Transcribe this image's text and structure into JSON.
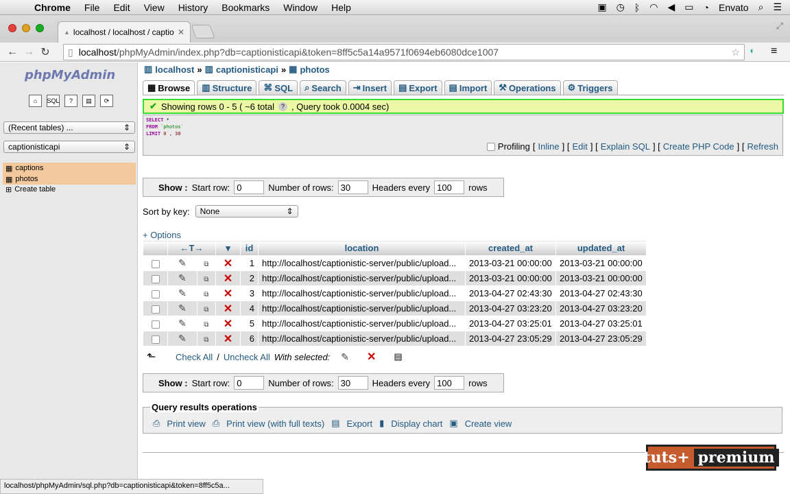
{
  "menubar": {
    "app": "Chrome",
    "items": [
      "File",
      "Edit",
      "View",
      "History",
      "Bookmarks",
      "Window",
      "Help"
    ],
    "user": "Envato"
  },
  "browser": {
    "tab_title": "localhost / localhost / captio",
    "url_host": "localhost",
    "url_path": "/phpMyAdmin/index.php?db=captionisticapi&token=8ff5c5a14a9571f0694eb6080dce1007"
  },
  "sidebar": {
    "logo": "phpMyAdmin",
    "recent": "(Recent tables) ...",
    "db": "captionisticapi",
    "tables": [
      "captions",
      "photos"
    ],
    "create": "Create table"
  },
  "breadcrumb": {
    "server": "localhost",
    "db": "captionisticapi",
    "table": "photos"
  },
  "tabs": [
    "Browse",
    "Structure",
    "SQL",
    "Search",
    "Insert",
    "Export",
    "Import",
    "Operations",
    "Triggers"
  ],
  "success": "Showing rows 0 - 5 ( ~6 total",
  "success2": ", Query took 0.0004 sec)",
  "sql": {
    "l1a": "SELECT",
    "l1b": "*",
    "l2a": "FROM",
    "l2b": "`photos`",
    "l3a": "LIMIT",
    "l3b": "0 , 30"
  },
  "sql_links": {
    "profiling": "Profiling",
    "inline": "Inline",
    "edit": "Edit",
    "explain": "Explain SQL",
    "php": "Create PHP Code",
    "refresh": "Refresh"
  },
  "show": {
    "label": "Show :",
    "start_label": "Start row:",
    "start": "0",
    "num_label": "Number of rows:",
    "num": "30",
    "headers_label": "Headers every",
    "headers": "100",
    "rows": "rows"
  },
  "sort": {
    "label": "Sort by key:",
    "value": "None"
  },
  "options": "+ Options",
  "columns": [
    "id",
    "location",
    "created_at",
    "updated_at"
  ],
  "rows": [
    {
      "id": "1",
      "location": "http://localhost/captionistic-server/public/upload...",
      "created_at": "2013-03-21 00:00:00",
      "updated_at": "2013-03-21 00:00:00"
    },
    {
      "id": "2",
      "location": "http://localhost/captionistic-server/public/upload...",
      "created_at": "2013-03-21 00:00:00",
      "updated_at": "2013-03-21 00:00:00"
    },
    {
      "id": "3",
      "location": "http://localhost/captionistic-server/public/upload...",
      "created_at": "2013-04-27 02:43:30",
      "updated_at": "2013-04-27 02:43:30"
    },
    {
      "id": "4",
      "location": "http://localhost/captionistic-server/public/upload...",
      "created_at": "2013-04-27 03:23:20",
      "updated_at": "2013-04-27 03:23:20"
    },
    {
      "id": "5",
      "location": "http://localhost/captionistic-server/public/upload...",
      "created_at": "2013-04-27 03:25:01",
      "updated_at": "2013-04-27 03:25:01"
    },
    {
      "id": "6",
      "location": "http://localhost/captionistic-server/public/upload...",
      "created_at": "2013-04-27 23:05:29",
      "updated_at": "2013-04-27 23:05:29"
    }
  ],
  "checkall": {
    "check": "Check All",
    "sep": "/",
    "uncheck": "Uncheck All",
    "with": "With selected:"
  },
  "qro": {
    "legend": "Query results operations",
    "print": "Print view",
    "print_full": "Print view (with full texts)",
    "export": "Export",
    "chart": "Display chart",
    "view": "Create view"
  },
  "status_url": "localhost/phpMyAdmin/sql.php?db=captionisticapi&token=8ff5c5a...",
  "watermark": {
    "a": "tuts+",
    "b": "premium"
  }
}
